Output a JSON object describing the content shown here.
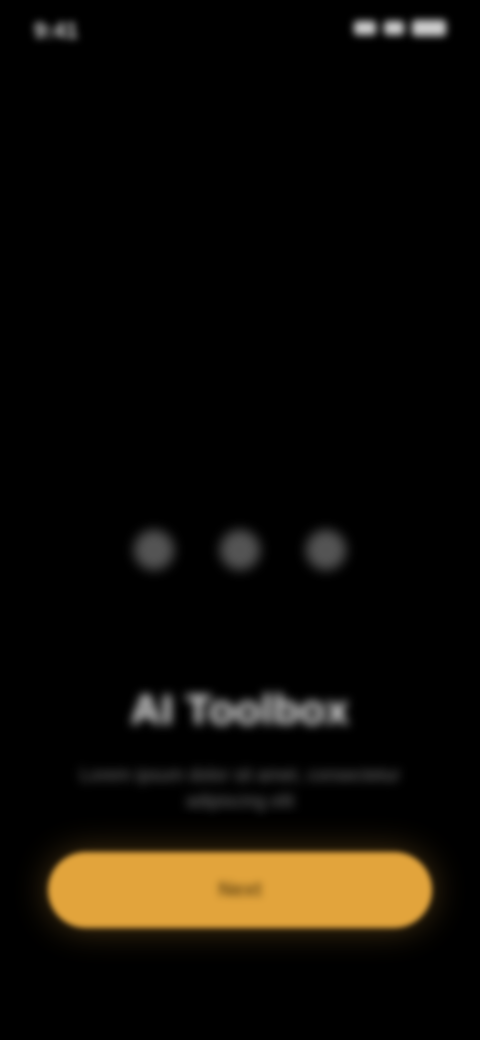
{
  "status_bar": {
    "time": "9:41",
    "icons": [
      "signal-icon",
      "wifi-icon",
      "battery-icon"
    ]
  },
  "feature_icons": [
    "circle-icon",
    "circle-icon",
    "circle-icon"
  ],
  "onboarding": {
    "title": "AI Toolbox",
    "subtitle": "Lorem ipsum dolor sit amet, consectetur adipiscing elit"
  },
  "cta": {
    "label": "Next"
  },
  "colors": {
    "background": "#000000",
    "accent": "#e2a43c"
  }
}
